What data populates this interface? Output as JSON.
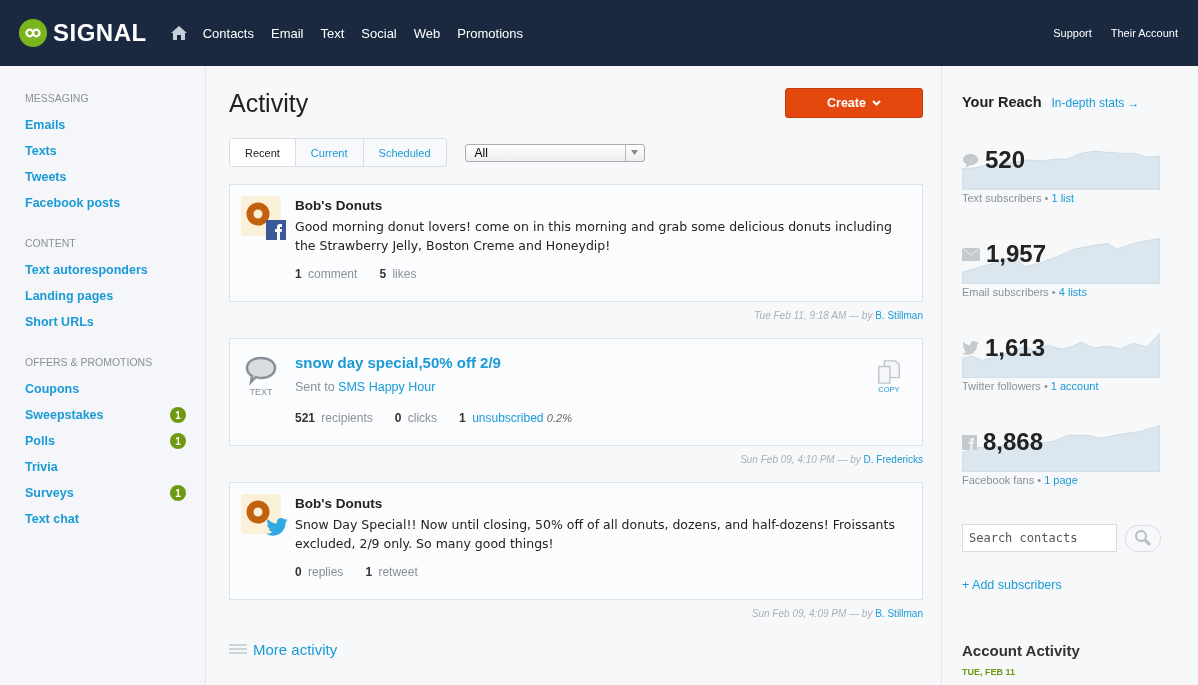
{
  "header": {
    "brand": "SIGNAL",
    "nav": [
      "Contacts",
      "Email",
      "Text",
      "Social",
      "Web",
      "Promotions"
    ],
    "right_links": [
      "Support",
      "Their Account"
    ]
  },
  "sidebar": {
    "sections": [
      {
        "title": "MESSAGING",
        "items": [
          {
            "label": "Emails"
          },
          {
            "label": "Texts"
          },
          {
            "label": "Tweets"
          },
          {
            "label": "Facebook posts"
          }
        ]
      },
      {
        "title": "CONTENT",
        "items": [
          {
            "label": "Text autoresponders"
          },
          {
            "label": "Landing pages"
          },
          {
            "label": "Short URLs"
          }
        ]
      },
      {
        "title": "OFFERS & PROMOTIONS",
        "items": [
          {
            "label": "Coupons"
          },
          {
            "label": "Sweepstakes",
            "badge": "1"
          },
          {
            "label": "Polls",
            "badge": "1"
          },
          {
            "label": "Trivia"
          },
          {
            "label": "Surveys",
            "badge": "1"
          },
          {
            "label": "Text chat"
          }
        ]
      }
    ]
  },
  "main": {
    "title": "Activity",
    "create_button": "Create",
    "tabs": [
      {
        "label": "Recent",
        "selected": true
      },
      {
        "label": "Current",
        "selected": false
      },
      {
        "label": "Scheduled",
        "selected": false
      }
    ],
    "filter": {
      "value": "All"
    },
    "posts": [
      {
        "kind": "facebook",
        "author": "Bob's Donuts",
        "body": "Good morning donut lovers! come on in this morning and grab some delicious donuts including the Strawberry Jelly, Boston Creme and Honeydip!",
        "stats": [
          {
            "count": "1",
            "label": "comment"
          },
          {
            "count": "5",
            "label": "likes"
          }
        ],
        "time": "Tue Feb 11, 9:18 AM — by",
        "by": "B. Stillman"
      },
      {
        "kind": "text",
        "type_label": "TEXT",
        "title": "snow day special,50% off 2/9",
        "sent_prefix": "Sent to",
        "sent_to": "SMS Happy Hour",
        "copy_label": "COPY",
        "stats": [
          {
            "count": "521",
            "label": "recipients"
          },
          {
            "count": "0",
            "label": "clicks"
          },
          {
            "count": "1",
            "label": "unsubscribed",
            "link": true,
            "extra": "0.2%"
          }
        ],
        "time": "Sun Feb 09, 4:10 PM — by",
        "by": "D. Fredericks"
      },
      {
        "kind": "twitter",
        "author": "Bob's Donuts",
        "body": "Snow Day Special!! Now until closing, 50% off of all donuts, dozens, and half-dozens! Froissants excluded, 2/9 only. So many good things!",
        "stats": [
          {
            "count": "0",
            "label": "replies"
          },
          {
            "count": "1",
            "label": "retweet"
          }
        ],
        "time": "Sun Feb 09, 4:09 PM — by",
        "by": "B. Stillman"
      }
    ],
    "more": "More activity"
  },
  "reach": {
    "title": "Your Reach",
    "link": "In-depth stats →",
    "stats": [
      {
        "kind": "text",
        "value": "520",
        "label": "Text subscribers •",
        "link": "1 list"
      },
      {
        "kind": "email",
        "value": "1,957",
        "label": "Email subscribers •",
        "link": "4 lists"
      },
      {
        "kind": "twitter",
        "value": "1,613",
        "label": "Twitter followers •",
        "link": "1 account"
      },
      {
        "kind": "facebook",
        "value": "8,868",
        "label": "Facebook fans •",
        "link": "1 page"
      }
    ],
    "search": {
      "placeholder": "Search contacts"
    },
    "add": "+ Add subscribers",
    "activity_title": "Account Activity",
    "activity_date": "TUE, FEB 11"
  }
}
